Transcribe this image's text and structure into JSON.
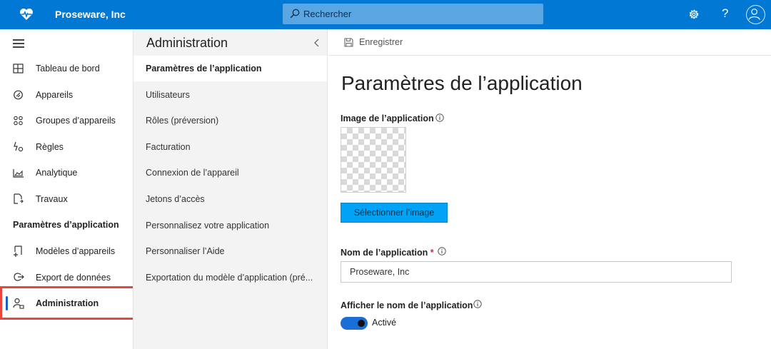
{
  "header": {
    "brand": "Proseware, Inc",
    "search_placeholder": "Rechercher",
    "help_label": "?"
  },
  "leftnav": {
    "items": [
      {
        "label": "Tableau de bord",
        "icon": "dashboard-icon"
      },
      {
        "label": "Appareils",
        "icon": "devices-icon"
      },
      {
        "label": "Groupes d’appareils",
        "icon": "device-groups-icon"
      },
      {
        "label": "Règles",
        "icon": "rules-icon"
      },
      {
        "label": "Analytique",
        "icon": "analytics-icon"
      },
      {
        "label": "Travaux",
        "icon": "jobs-icon"
      }
    ],
    "section_title": "Paramètres d’application",
    "section_items": [
      {
        "label": "Modèles d’appareils",
        "icon": "device-templates-icon"
      },
      {
        "label": "Export de données",
        "icon": "data-export-icon"
      },
      {
        "label": "Administration",
        "icon": "administration-icon",
        "active": true
      }
    ]
  },
  "midpanel": {
    "title": "Administration",
    "items": [
      {
        "label": "Paramètres de l’application",
        "selected": true
      },
      {
        "label": "Utilisateurs"
      },
      {
        "label": "Rôles (préversion)"
      },
      {
        "label": "Facturation"
      },
      {
        "label": "Connexion de l’appareil"
      },
      {
        "label": "Jetons d’accès"
      },
      {
        "label": "Personnalisez votre application"
      },
      {
        "label": "Personnaliser l’Aide"
      },
      {
        "label": "Exportation du modèle d’application (pré..."
      }
    ]
  },
  "main": {
    "toolbar": {
      "save_label": "Enregistrer"
    },
    "title": "Paramètres de l’application",
    "app_image": {
      "label": "Image de l’application",
      "button_label": "Sélectionner l’image"
    },
    "app_name": {
      "label": "Nom de l’application",
      "required_mark": "*",
      "value": "Proseware, Inc"
    },
    "show_name": {
      "label": "Afficher le nom de l’application",
      "toggle_on": true,
      "toggle_label": "Activé"
    }
  },
  "colors": {
    "header_bg": "#0078d4",
    "accent_button": "#00a3f5",
    "active_bar": "#1a5fc8",
    "highlight_box": "#e8453c"
  }
}
